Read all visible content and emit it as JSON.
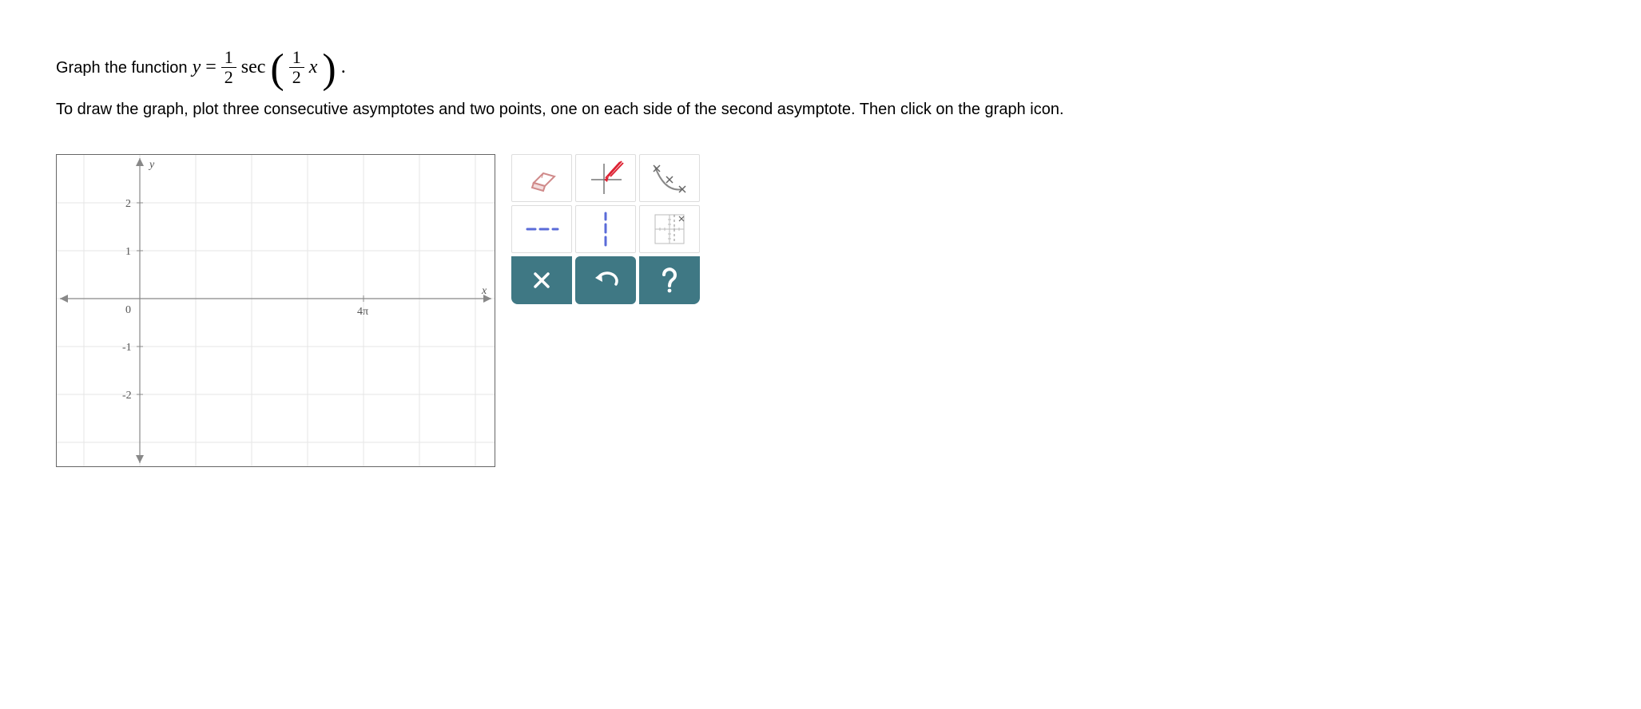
{
  "question": {
    "prefix": "Graph the function ",
    "var": "y",
    "equals": " = ",
    "coeff_num": "1",
    "coeff_den": "2",
    "func": " sec ",
    "arg_num": "1",
    "arg_den": "2",
    "arg_var": "x",
    "period": ".",
    "instructions": "To draw the graph, plot three consecutive asymptotes and two points, one on each side of the second asymptote. Then click on the graph icon."
  },
  "graph": {
    "y_label": "y",
    "x_label": "x",
    "y_ticks": [
      "2",
      "1",
      "0",
      "-1",
      "-2"
    ],
    "x_tick": "4π"
  },
  "tools": {
    "eraser": "eraser-icon",
    "pencil": "pencil-icon",
    "points": "points-tool-icon",
    "h_asymptote": "horizontal-asymptote-icon",
    "v_asymptote": "vertical-asymptote-icon",
    "graph_icon": "graph-curve-icon",
    "clear": "✕",
    "undo": "↶",
    "help": "?"
  }
}
